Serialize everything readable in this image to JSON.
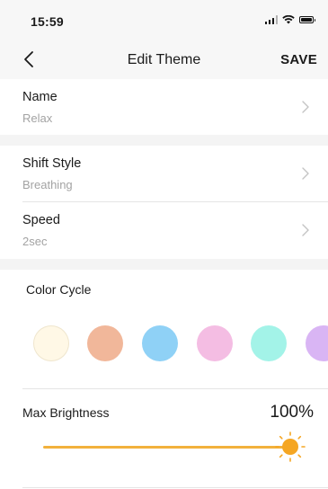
{
  "status_bar": {
    "time": "15:59"
  },
  "header": {
    "title": "Edit Theme",
    "save_label": "SAVE"
  },
  "settings": [
    {
      "key": "name",
      "title": "Name",
      "value": "Relax"
    },
    {
      "key": "shift_style",
      "title": "Shift Style",
      "value": "Breathing"
    },
    {
      "key": "speed",
      "title": "Speed",
      "value": "2sec"
    }
  ],
  "color_cycle": {
    "label": "Color Cycle",
    "colors": [
      "#fff8e6",
      "#f1b79a",
      "#8fd1f6",
      "#f4bde3",
      "#a3f3e8",
      "#d9b5f4"
    ]
  },
  "brightness": {
    "label": "Max Brightness",
    "value_text": "100%",
    "level": 1.0
  },
  "theme": {
    "accent": "#f2b13c",
    "thumb": "#f5a623"
  }
}
